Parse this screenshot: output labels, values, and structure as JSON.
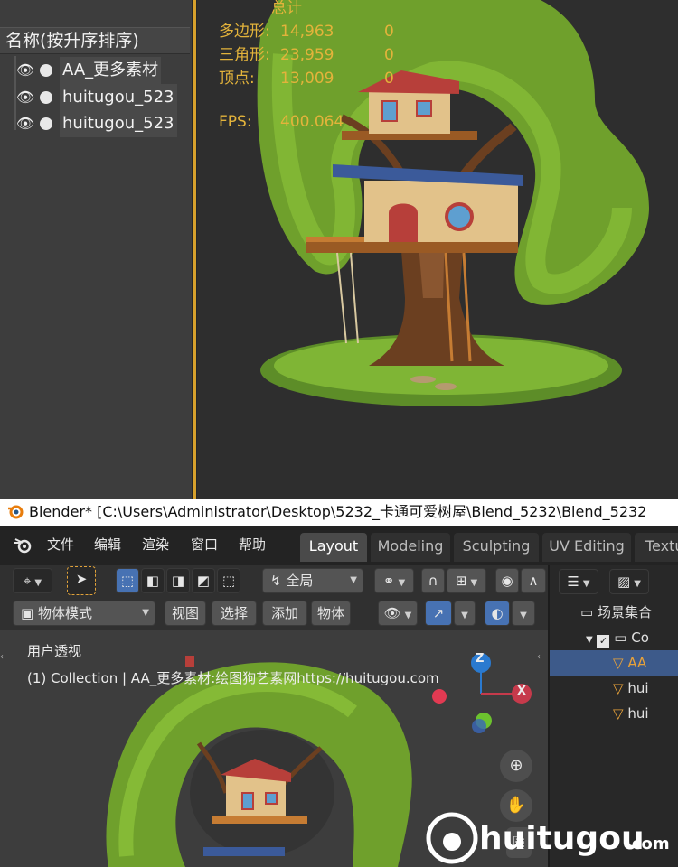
{
  "top_outliner": {
    "header": "名称(按升序排序)",
    "rows": [
      "AA_更多素材",
      "huitugou_523",
      "huitugou_523"
    ]
  },
  "stats": {
    "header": "总计",
    "rows": [
      {
        "label": "多边形:",
        "value": "14,963",
        "sel": "0"
      },
      {
        "label": "三角形:",
        "value": "23,959",
        "sel": "0"
      },
      {
        "label": "顶点:",
        "value": "13,009",
        "sel": "0"
      },
      {
        "label": "FPS:",
        "value": "400.064",
        "sel": ""
      }
    ]
  },
  "titlebar": {
    "title": "Blender* [C:\\Users\\Administrator\\Desktop\\5232_卡通可爱树屋\\Blend_5232\\Blend_5232"
  },
  "menu": {
    "items": [
      "文件",
      "编辑",
      "渲染",
      "窗口",
      "帮助"
    ],
    "tabs": [
      "Layout",
      "Modeling",
      "Sculpting",
      "UV Editing",
      "Textu"
    ]
  },
  "header": {
    "transform_orientation": "全局",
    "mode": "物体模式",
    "menus": [
      "视图",
      "选择",
      "添加",
      "物体"
    ]
  },
  "viewport": {
    "view_name": "用户透视",
    "collection_info": "(1) Collection | AA_更多素材:绘图狗艺素网https://huitugou.com",
    "gizmo": {
      "z": "Z",
      "x": "X"
    }
  },
  "right_outliner": {
    "scene_collection": "场景集合",
    "rows": [
      "Co",
      "AA",
      "hui",
      "hui"
    ]
  },
  "watermark": {
    "brand": "huitugou",
    "suffix": ".com"
  },
  "colors": {
    "accent_orange": "#d7a12c",
    "selection_blue": "#3d5a8a",
    "stats_yellow": "#e3b33b"
  }
}
